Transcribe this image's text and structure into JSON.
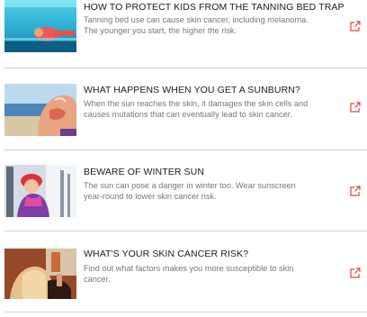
{
  "articles": [
    {
      "title": "HOW TO PROTECT KIDS FROM THE TANNING BED TRAP",
      "description": "Tanning bed use can cause skin cancer, including melanoma. The younger you start, the higher the risk.",
      "icon": "external-link-icon"
    },
    {
      "title": "WHAT HAPPENS WHEN YOU GET A SUNBURN?",
      "description": "When the sun reaches the skin, it damages the skin cells and causes mutations that can eventually lead to skin cancer.",
      "icon": "external-link-icon"
    },
    {
      "title": "BEWARE OF WINTER SUN",
      "description": "The sun can pose a danger in winter too. Wear sunscreen year-round to lower skin cancer risk.",
      "icon": "external-link-icon"
    },
    {
      "title": "WHAT'S YOUR SKIN CANCER RISK?",
      "description": "Find out what factors makes you more susceptible to skin cancer.",
      "icon": "external-link-icon"
    }
  ],
  "colors": {
    "accent": "#e0443a",
    "title": "#1a1a1a",
    "description": "#777777",
    "divider": "#cfcfcf"
  }
}
